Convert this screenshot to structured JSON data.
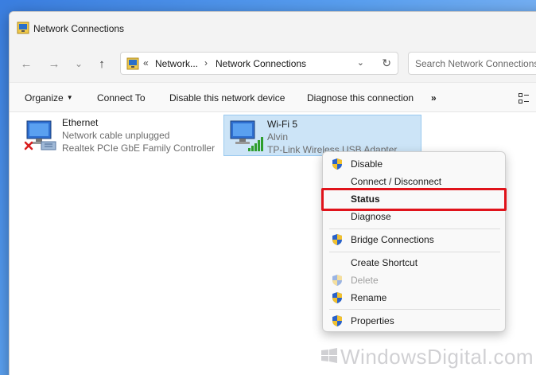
{
  "window": {
    "title": "Network Connections"
  },
  "nav": {
    "back": "←",
    "forward": "→",
    "recent": "⌄",
    "up": "↑"
  },
  "address": {
    "overflow": "«",
    "crumb1": "Network...",
    "sep": "›",
    "crumb2": "Network Connections",
    "dropdown": "⌄",
    "refresh": "↻"
  },
  "search": {
    "placeholder": "Search Network Connections"
  },
  "toolbar": {
    "organize": "Organize",
    "connect_to": "Connect To",
    "disable": "Disable this network device",
    "diagnose": "Diagnose this connection",
    "more": "»"
  },
  "connections": [
    {
      "name": "Ethernet",
      "status": "Network cable unplugged",
      "device": "Realtek PCIe GbE Family Controller"
    },
    {
      "name": "Wi-Fi 5",
      "status": "Alvin",
      "device": "TP-Link Wireless USB Adapter"
    }
  ],
  "context_menu": {
    "disable": "Disable",
    "connect_disconnect": "Connect / Disconnect",
    "status": "Status",
    "diagnose": "Diagnose",
    "bridge": "Bridge Connections",
    "shortcut": "Create Shortcut",
    "delete": "Delete",
    "rename": "Rename",
    "properties": "Properties"
  },
  "watermark": {
    "text": "WindowsDigital.com"
  },
  "colors": {
    "highlight": "#e0131b",
    "selection": "#cce4f7",
    "accent": "#0067c0"
  }
}
